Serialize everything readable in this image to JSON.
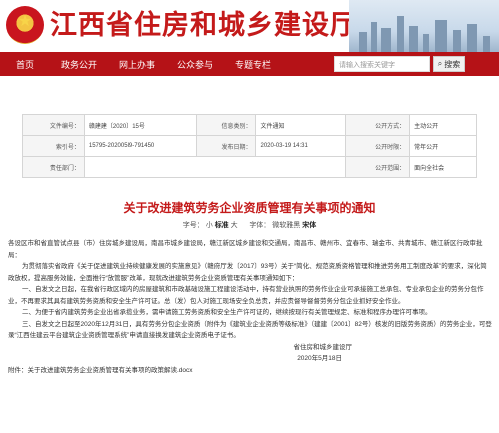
{
  "site": {
    "title": "江西省住房和城乡建设厅"
  },
  "nav": {
    "items": [
      "首页",
      "政务公开",
      "网上办事",
      "公众参与",
      "专题专栏"
    ],
    "search_placeholder": "请输入搜索关键字",
    "search_button": "搜索"
  },
  "info": {
    "file_no_label": "文件编号：",
    "file_no_value": "赣建建〔2020〕15号",
    "category_label": "信息类别：",
    "category_value": "文件通知",
    "method_label": "公开方式：",
    "method_value": "主动公开",
    "index_label": "索引号：",
    "index_value": "15795-202005l9-791450",
    "date_label": "发布日期：",
    "date_value": "2020-03-19 14:31",
    "period_label": "公开时限：",
    "period_value": "常年公开",
    "unit_label": "责任部门：",
    "unit_value": "",
    "scope_label": "公开范围：",
    "scope_value": "面向全社会"
  },
  "article": {
    "title": "关于改进建筑劳务企业资质管理有关事项的通知",
    "font_label": "字号：",
    "font_small": "小",
    "font_standard": "标准",
    "font_large": "大",
    "font_face_label": "字体：",
    "font_face_1": "微软雅黑",
    "font_face_2": "宋体",
    "p1": "各设区市和省直管试点县（市）住房城乡建设局，南昌市城乡建设局，赣江新区城乡建设和交通局，南昌市、赣州市、宜春市、瑞金市、共青城市、赣江新区行政审批局：",
    "p2": "为贯彻落实省政府《关于促进建筑业持续健康发展的实施意见》（赣府厅发〔2017〕93号）关于“简化、规范资质资格管理和推进劳务用工制度改革”的要求，深化简政放权，提高服务效能，全面推行“放管服”改革，现就改进建筑劳务企业资质管理有关事项通知如下：",
    "p3": "一、自发文之日起，在我省行政区域内的房屋建筑和市政基础设施工程建设活动中，持有营业执照的劳务作业企业可承接施工总承包、专业承包企业的劳务分包作业，不再要求其具有建筑劳务资质和安全生产许可证。总（发）包人对施工现场安全负总责，并应责督导督督劳务分包企业抓好安全作业。",
    "p4": "二、为便于省内建筑劳务企业出省承揽业务，需申请施工劳务资质和安全生产许可证的，继续按现行有关管理规定、标准和程序办理许可事项。",
    "p5": "三、自发文之日起至2020年12月31日，具有劳务分包企业资质（附件为《建筑业企业资质等级标准》（建建〔2001〕82号）核发的旧版劳务资质）的劳务企业，可登录“江西住建云平台建筑企业资质管理系统”申请直接换发建筑企业资质电子证书。",
    "signer": "省住房和城乡建设厅",
    "sign_date": "2020年5月18日",
    "attachment_label": "附件：",
    "attachment_text": "关于改进建筑劳务企业资质管理有关事项的政策解读.docx"
  }
}
